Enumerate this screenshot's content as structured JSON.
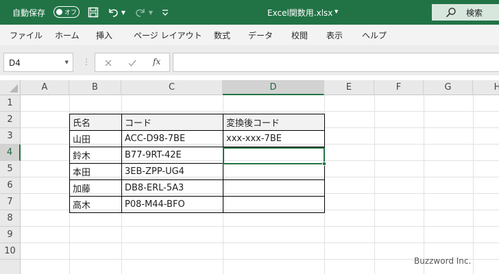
{
  "titlebar": {
    "autosave_label": "自動保存",
    "autosave_state": "オフ",
    "doc_title": "Excel関数用.xlsx",
    "search_label": "検索"
  },
  "ribbon": {
    "tabs": [
      "ファイル",
      "ホーム",
      "挿入",
      "ページ レイアウト",
      "数式",
      "データ",
      "校閲",
      "表示",
      "ヘルプ"
    ]
  },
  "formula_bar": {
    "name_box": "D4",
    "fx_label": "fx",
    "formula": ""
  },
  "grid": {
    "columns": [
      "A",
      "B",
      "C",
      "D",
      "E",
      "F",
      "G",
      "H"
    ],
    "rows": [
      "1",
      "2",
      "3",
      "4",
      "5",
      "6",
      "7",
      "8",
      "9",
      "10"
    ],
    "selected_column": "D",
    "selected_row": "4"
  },
  "table": {
    "headers": [
      "氏名",
      "コード",
      "変換後コード"
    ],
    "rows": [
      [
        "山田",
        "ACC-D98-7BE",
        "xxx-xxx-7BE"
      ],
      [
        "鈴木",
        "B77-9RT-42E",
        ""
      ],
      [
        "本田",
        "3EB-ZPP-UG4",
        ""
      ],
      [
        "加藤",
        "DB8-ERL-5A3",
        ""
      ],
      [
        "高木",
        "P08-M44-BFO",
        ""
      ]
    ]
  },
  "watermark": "Buzzword Inc.",
  "colors": {
    "accent": "#217346",
    "selection_header": "#d2d2d2"
  }
}
